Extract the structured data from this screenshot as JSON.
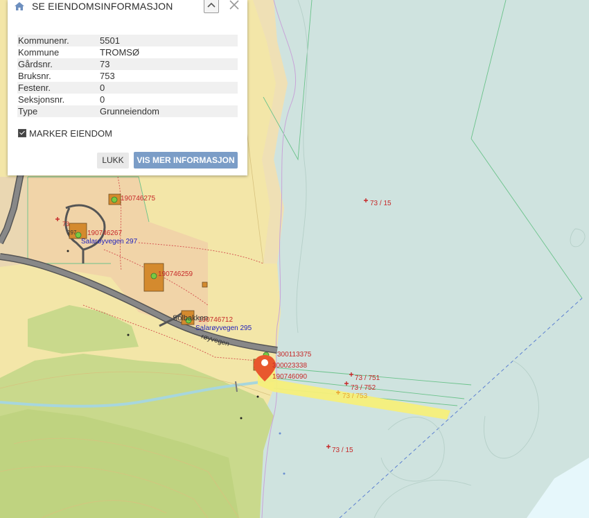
{
  "panel": {
    "title": "SE EIENDOMSINFORMASJON",
    "rows": [
      {
        "key": "Kommunenr.",
        "value": "5501"
      },
      {
        "key": "Kommune",
        "value": "TROMSØ"
      },
      {
        "key": "Gårdsnr.",
        "value": "73"
      },
      {
        "key": "Bruksnr.",
        "value": "753"
      },
      {
        "key": "Festenr.",
        "value": "0"
      },
      {
        "key": "Seksjonsnr.",
        "value": "0"
      },
      {
        "key": "Type",
        "value": "Grunneiendom"
      }
    ],
    "checkbox_label": "MARKER EIENDOM",
    "checkbox_checked": true,
    "close_label": "LUKK",
    "more_label": "VIS MER INFORMASJON",
    "accent_color": "#7b9dc7"
  },
  "map": {
    "parcel_labels_red": [
      "73 / 15",
      "73 / 751",
      "73 / 752",
      "73 / 15"
    ],
    "parcel_labels_orange": [
      "73 / 753"
    ],
    "building_ids": [
      "190746275",
      "190746267",
      "190746259",
      "190746712",
      "300113375",
      "300023338",
      "190746090"
    ],
    "small_labels": [
      "297",
      "73"
    ],
    "addresses": [
      "Salarøyvegen 297",
      "Salarøyvegen 295"
    ],
    "place_name": "Solbakken",
    "road_name": "røyvegen",
    "colors": {
      "sea": "#cfe3df",
      "land_yellow": "#f3e6a8",
      "forest": "#c9d98c",
      "road": "#666666",
      "parcel_red": "#c62828",
      "selected_parcel": "#f5ef7a",
      "marker": "#e8572e"
    }
  }
}
